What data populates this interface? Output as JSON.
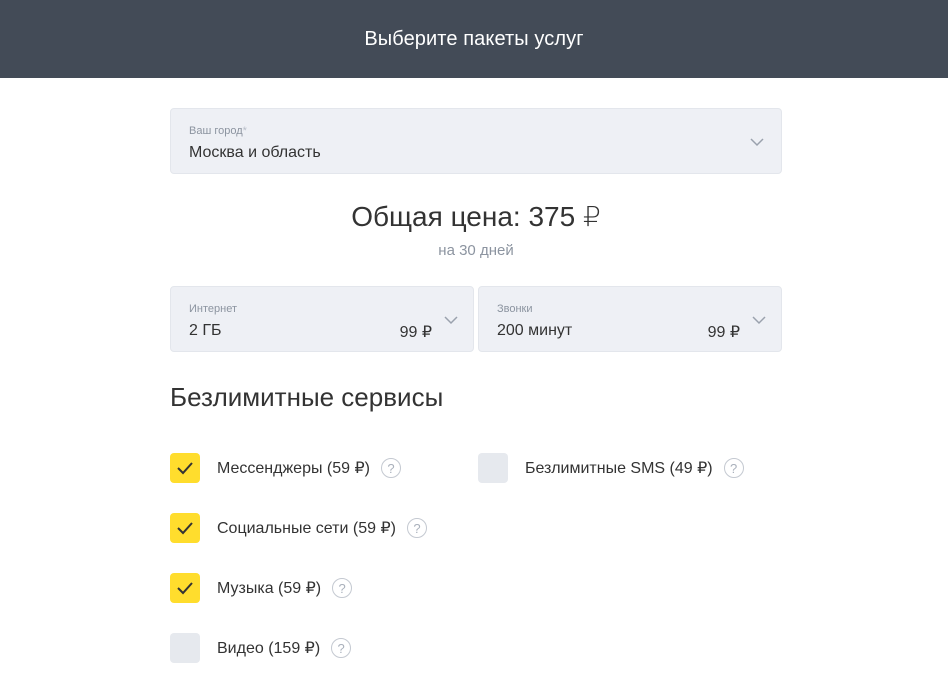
{
  "header": {
    "title": "Выберите пакеты услуг"
  },
  "city": {
    "label": "Ваш город",
    "required_mark": "*",
    "value": "Москва и область",
    "icon": "chevron-down-icon"
  },
  "summary": {
    "total_text": "Общая цена: 375 ₽",
    "period_text": "на 30 дней"
  },
  "packages": {
    "internet": {
      "label": "Интернет",
      "value": "2 ГБ",
      "price": "99 ₽"
    },
    "calls": {
      "label": "Звонки",
      "value": "200 минут",
      "price": "99 ₽"
    }
  },
  "unlimited": {
    "title": "Безлимитные сервисы",
    "items": [
      {
        "label": "Мессенджеры (59 ₽)",
        "checked": true
      },
      {
        "label": "Социальные сети (59 ₽)",
        "checked": true
      },
      {
        "label": "Музыка (59 ₽)",
        "checked": true
      },
      {
        "label": "Видео (159 ₽)",
        "checked": false
      },
      {
        "label": "Безлимитные SMS (49 ₽)",
        "checked": false
      }
    ],
    "help_glyph": "?"
  },
  "colors": {
    "header_bg": "#434b57",
    "accent_yellow": "#ffdd2d",
    "field_bg": "#eef0f5",
    "muted_text": "#8c94a0"
  }
}
